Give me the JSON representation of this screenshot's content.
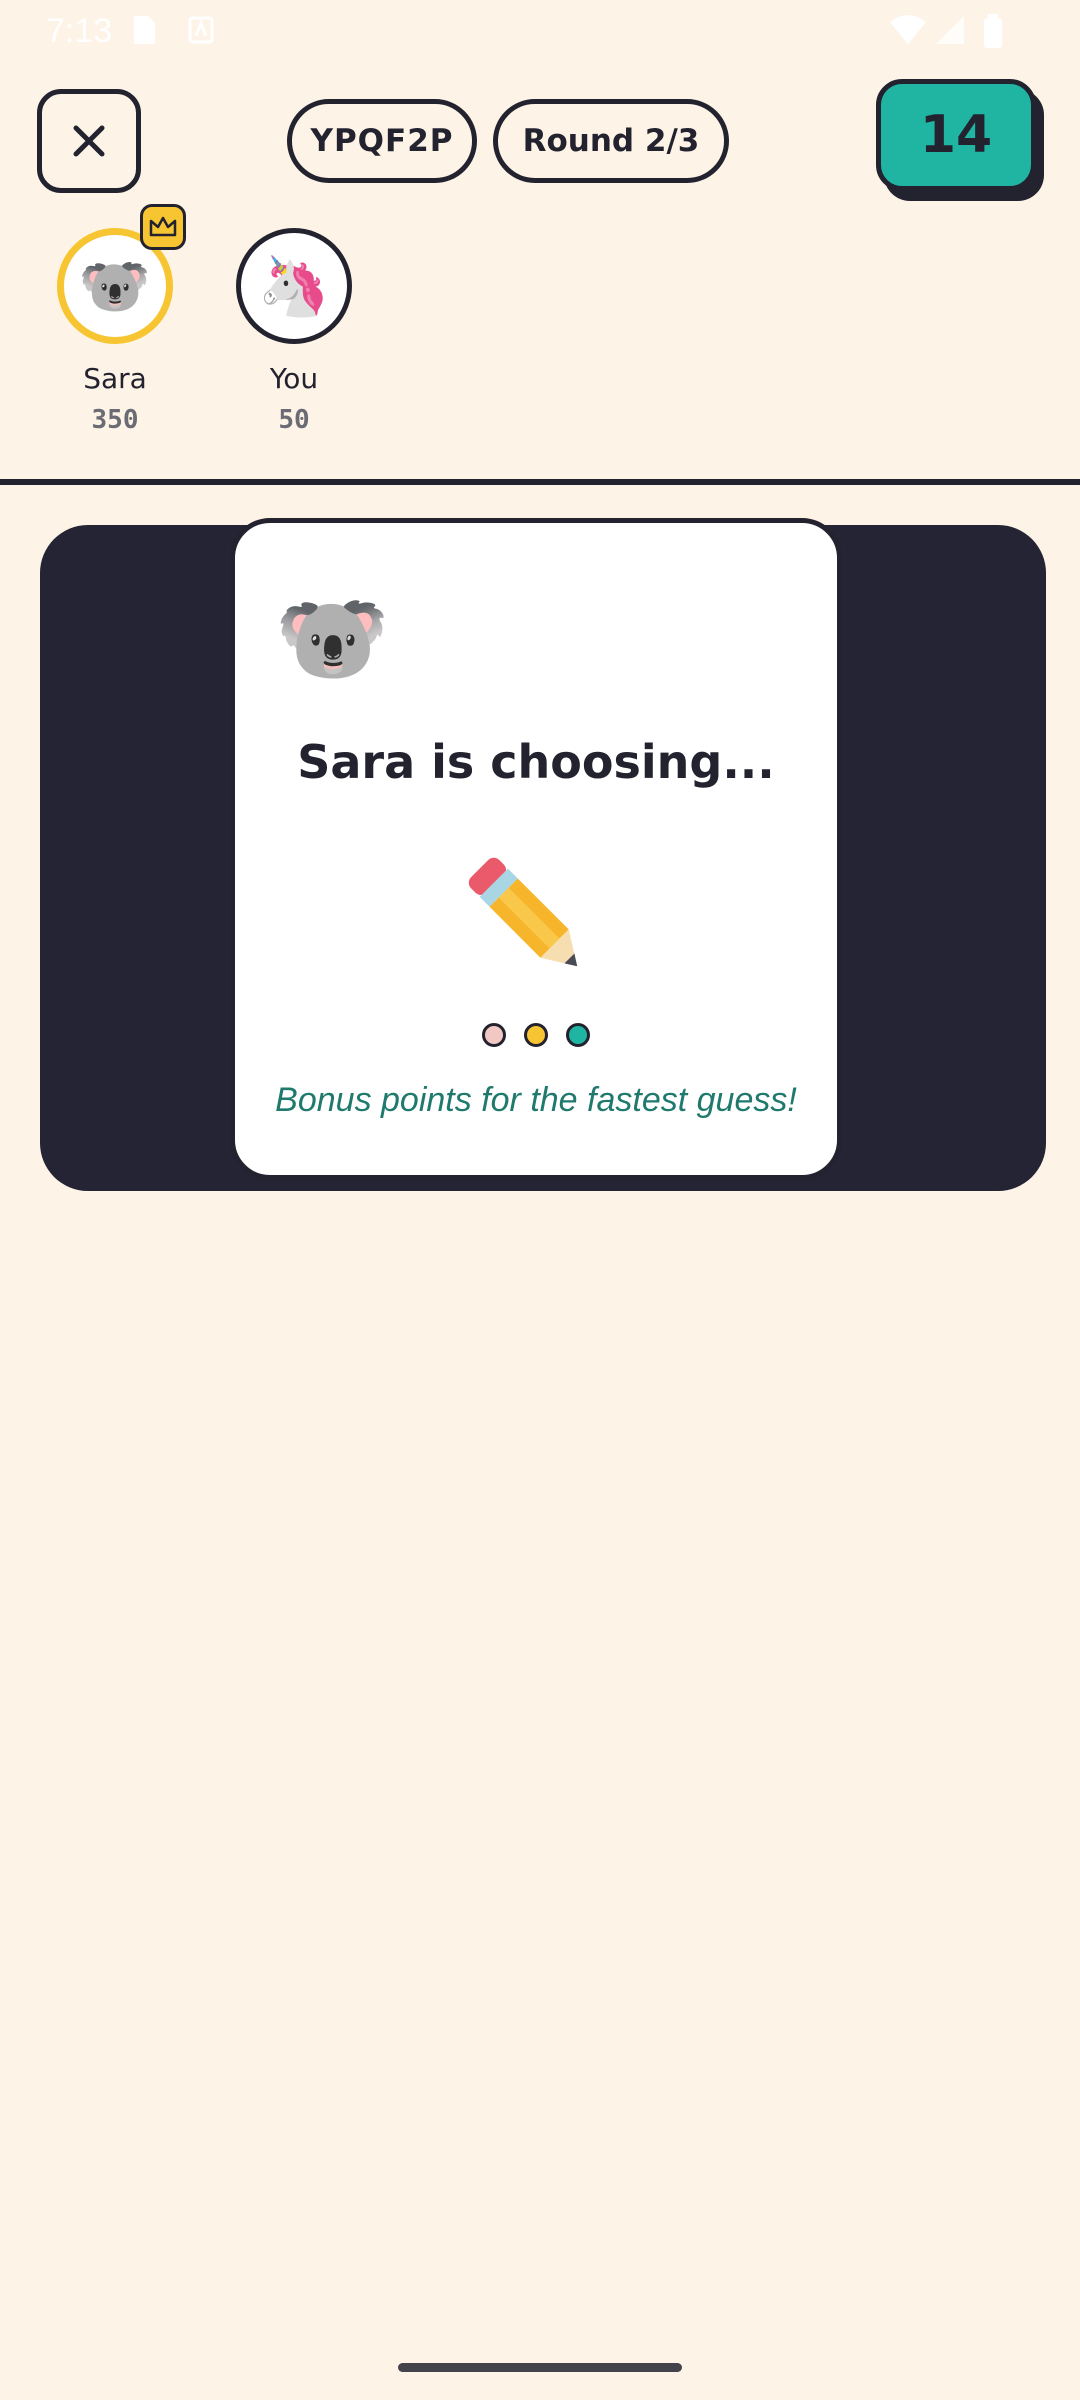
{
  "status_bar": {
    "time": "7:13"
  },
  "header": {
    "close_icon": "close-icon",
    "room_code": "YPQF2P",
    "round_label": "Round 2/3",
    "timer_value": "14"
  },
  "players": [
    {
      "name": "Sara",
      "score": "350",
      "avatar": "🐨",
      "leader": true
    },
    {
      "name": "You",
      "score": "50",
      "avatar": "🦄",
      "leader": false
    }
  ],
  "choosing_card": {
    "avatar": "🐨",
    "title": "Sara is choosing...",
    "hint": "Bonus points for the fastest guess!",
    "dots": [
      "#f2c9c2",
      "#f7c531",
      "#1fb5a2"
    ]
  },
  "colors": {
    "background": "#fdf3e6",
    "ink": "#23222f",
    "accent_teal": "#1fb5a2",
    "accent_yellow": "#f7c531",
    "canvas": "#252435",
    "hint_text": "#1f7a6d"
  }
}
